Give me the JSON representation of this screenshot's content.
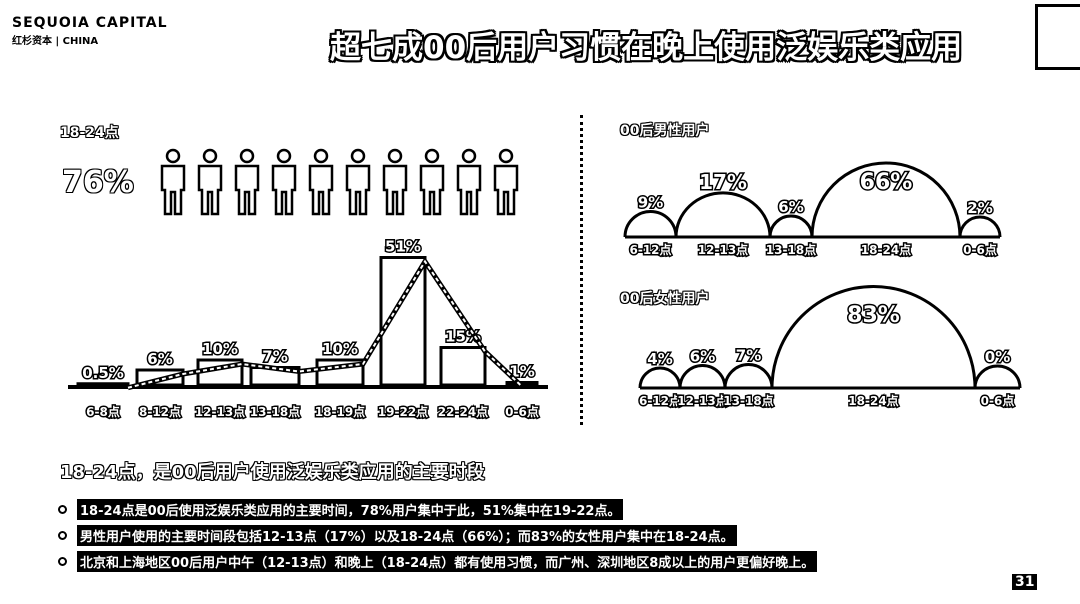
{
  "logo": {
    "line1": "SEQUOIA CAPITAL",
    "line2": "红杉资本 | CHINA"
  },
  "title": "超七成00后用户习惯在晚上使用泛娱乐类应用",
  "left": {
    "label": "18-24点",
    "percent": "76%",
    "person_count": 10
  },
  "chart_data": [
    {
      "type": "bar",
      "title": "",
      "categories": [
        "6-8点",
        "8-12点",
        "12-13点",
        "13-18点",
        "18-19点",
        "19-22点",
        "22-24点",
        "0-6点"
      ],
      "values": [
        0.5,
        6,
        10,
        7,
        10,
        51,
        15,
        1
      ],
      "value_labels": [
        "0.5%",
        "6%",
        "10%",
        "7%",
        "10%",
        "51%",
        "15%",
        "1%"
      ],
      "ylim": [
        0,
        55
      ]
    },
    {
      "type": "area",
      "title": "00后男性用户",
      "categories": [
        "6-12点",
        "12-13点",
        "13-18点",
        "18-24点",
        "0-6点"
      ],
      "values": [
        9,
        17,
        6,
        66,
        2
      ],
      "value_labels": [
        "9%",
        "17%",
        "6%",
        "66%",
        "2%"
      ]
    },
    {
      "type": "area",
      "title": "00后女性用户",
      "categories": [
        "6-12点",
        "12-13点",
        "13-18点",
        "18-24点",
        "0-6点"
      ],
      "values": [
        4,
        6,
        7,
        83,
        0
      ],
      "value_labels": [
        "4%",
        "6%",
        "7%",
        "83%",
        "0%"
      ]
    }
  ],
  "summary": "18-24点，是00后用户使用泛娱乐类应用的主要时段",
  "bullets": [
    "18-24点是00后使用泛娱乐类应用的主要时间，78%用户集中于此，51%集中在19-22点。",
    "男性用户使用的主要时间段包括12-13点（17%）以及18-24点（66%）；而83%的女性用户集中在18-24点。",
    "北京和上海地区00后用户中午（12-13点）和晚上（18-24点）都有使用习惯，而广州、深圳地区8成以上的用户更偏好晚上。"
  ],
  "page_number": "31"
}
